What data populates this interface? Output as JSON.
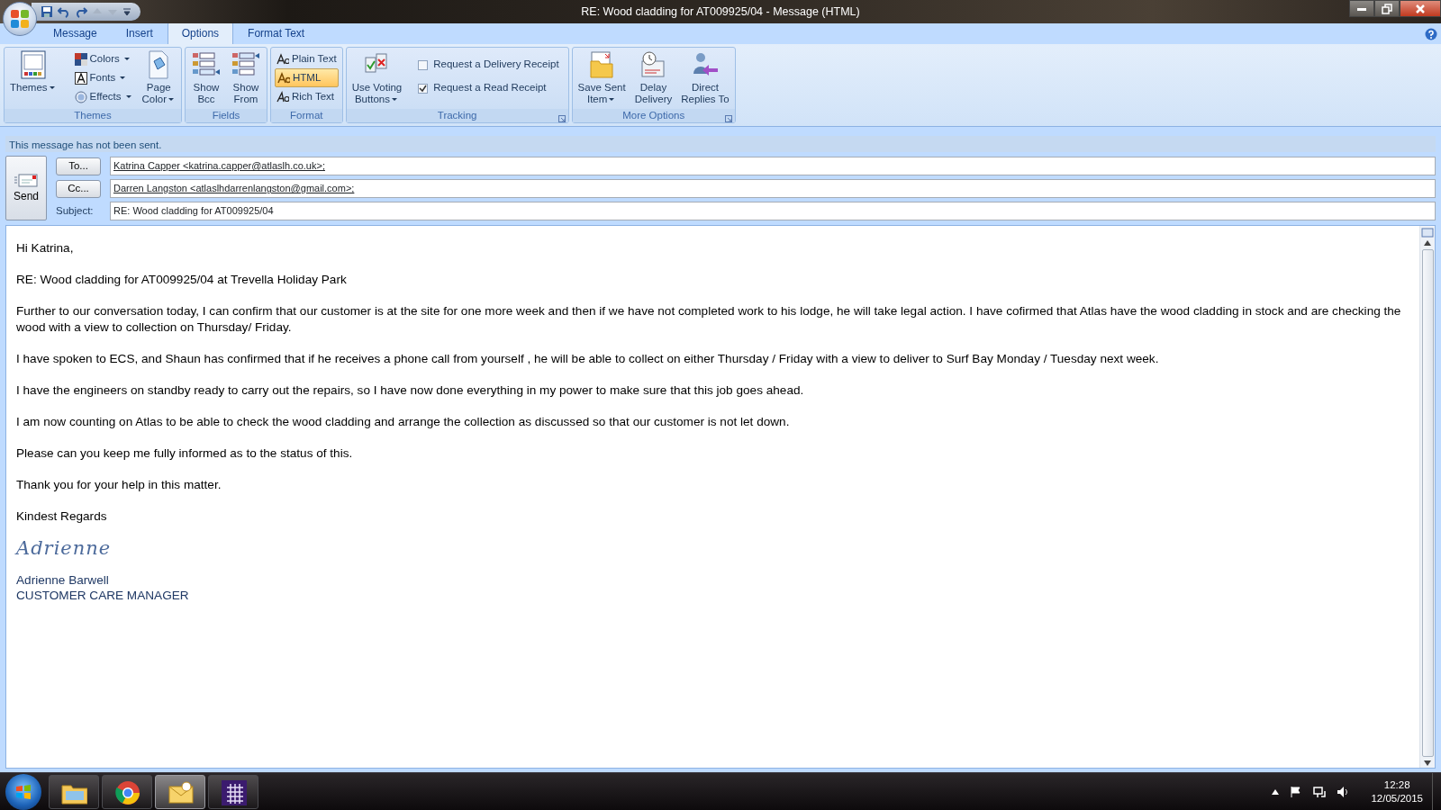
{
  "window": {
    "title": "RE: Wood cladding for AT009925/04 - Message (HTML)"
  },
  "tabs": [
    {
      "label": "Message",
      "selected": false
    },
    {
      "label": "Insert",
      "selected": false
    },
    {
      "label": "Options",
      "selected": true
    },
    {
      "label": "Format Text",
      "selected": false
    }
  ],
  "ribbon_groups": [
    {
      "label": "Themes",
      "launcher": false,
      "items": [
        {
          "kind": "large",
          "lines": [
            "Themes"
          ],
          "dropdown": true
        },
        {
          "kind": "small",
          "label": "Colors",
          "dropdown": true
        },
        {
          "kind": "small",
          "label": "Fonts",
          "dropdown": true
        },
        {
          "kind": "small",
          "label": "Effects",
          "dropdown": true
        },
        {
          "kind": "large",
          "lines": [
            "Page",
            "Color"
          ],
          "dropdown": true
        }
      ]
    },
    {
      "label": "Fields",
      "launcher": false,
      "items": [
        {
          "kind": "large",
          "lines": [
            "Show",
            "Bcc"
          ],
          "dropdown": false
        },
        {
          "kind": "large",
          "lines": [
            "Show",
            "From"
          ],
          "dropdown": false
        }
      ]
    },
    {
      "label": "Format",
      "launcher": false,
      "items": [
        {
          "kind": "option",
          "label": "Plain Text",
          "selected": false
        },
        {
          "kind": "option",
          "label": "HTML",
          "selected": true
        },
        {
          "kind": "option",
          "label": "Rich Text",
          "selected": false
        }
      ]
    },
    {
      "label": "Tracking",
      "launcher": true,
      "items": [
        {
          "kind": "large",
          "lines": [
            "Use Voting",
            "Buttons"
          ],
          "dropdown": true
        },
        {
          "kind": "check",
          "label": "Request a Delivery Receipt",
          "checked": false
        },
        {
          "kind": "check",
          "label": "Request a Read Receipt",
          "checked": true
        }
      ]
    },
    {
      "label": "More Options",
      "launcher": true,
      "items": [
        {
          "kind": "large",
          "lines": [
            "Save Sent",
            "Item"
          ],
          "dropdown": true
        },
        {
          "kind": "large",
          "lines": [
            "Delay",
            "Delivery"
          ],
          "dropdown": false
        },
        {
          "kind": "large",
          "lines": [
            "Direct",
            "Replies To"
          ],
          "dropdown": false
        }
      ]
    }
  ],
  "info_bar": "This message has not been sent.",
  "send_button": "Send",
  "fields": [
    {
      "button": "To...",
      "value": "Katrina Capper <katrina.capper@atlaslh.co.uk>;"
    },
    {
      "button": "Cc...",
      "value": "Darren Langston <atlaslhdarrenlangston@gmail.com>;"
    },
    {
      "label": "Subject:",
      "value": "RE: Wood cladding for AT009925/04"
    }
  ],
  "body": {
    "paragraphs": [
      "Hi Katrina,",
      "RE: Wood cladding for AT009925/04 at Trevella Holiday Park",
      "Further to our conversation today,  I can confirm that our customer is at the site for one more week and then if we have not completed work to his lodge, he will take legal action.  I have cofirmed that Atlas have the wood cladding in stock and are checking the wood with a view to collection on Thursday/ Friday.",
      "I have spoken to ECS, and Shaun has confirmed that if he receives a phone call  from yourself , he will be able to  collect on either Thursday / Friday with a view to deliver to Surf Bay Monday / Tuesday next week.",
      "I have the engineers on standby ready to carry out the repairs, so I have now done everything in my power to make sure that this job goes ahead.",
      "I am now counting on Atlas to be able to check the wood cladding and arrange the collection as discussed so that our customer is not let down.",
      "Please can you keep me fully informed as to the status of this.",
      "Thank you for your help in this matter.",
      "Kindest Regards"
    ],
    "signature": {
      "script": "Adrienne",
      "name": "Adrienne Barwell",
      "title": "CUSTOMER CARE MANAGER"
    }
  },
  "taskbar": {
    "apps": [
      {
        "selected": false
      },
      {
        "selected": false
      },
      {
        "selected": true
      },
      {
        "selected": false
      }
    ],
    "time": "12:28",
    "date": "12/05/2015"
  }
}
